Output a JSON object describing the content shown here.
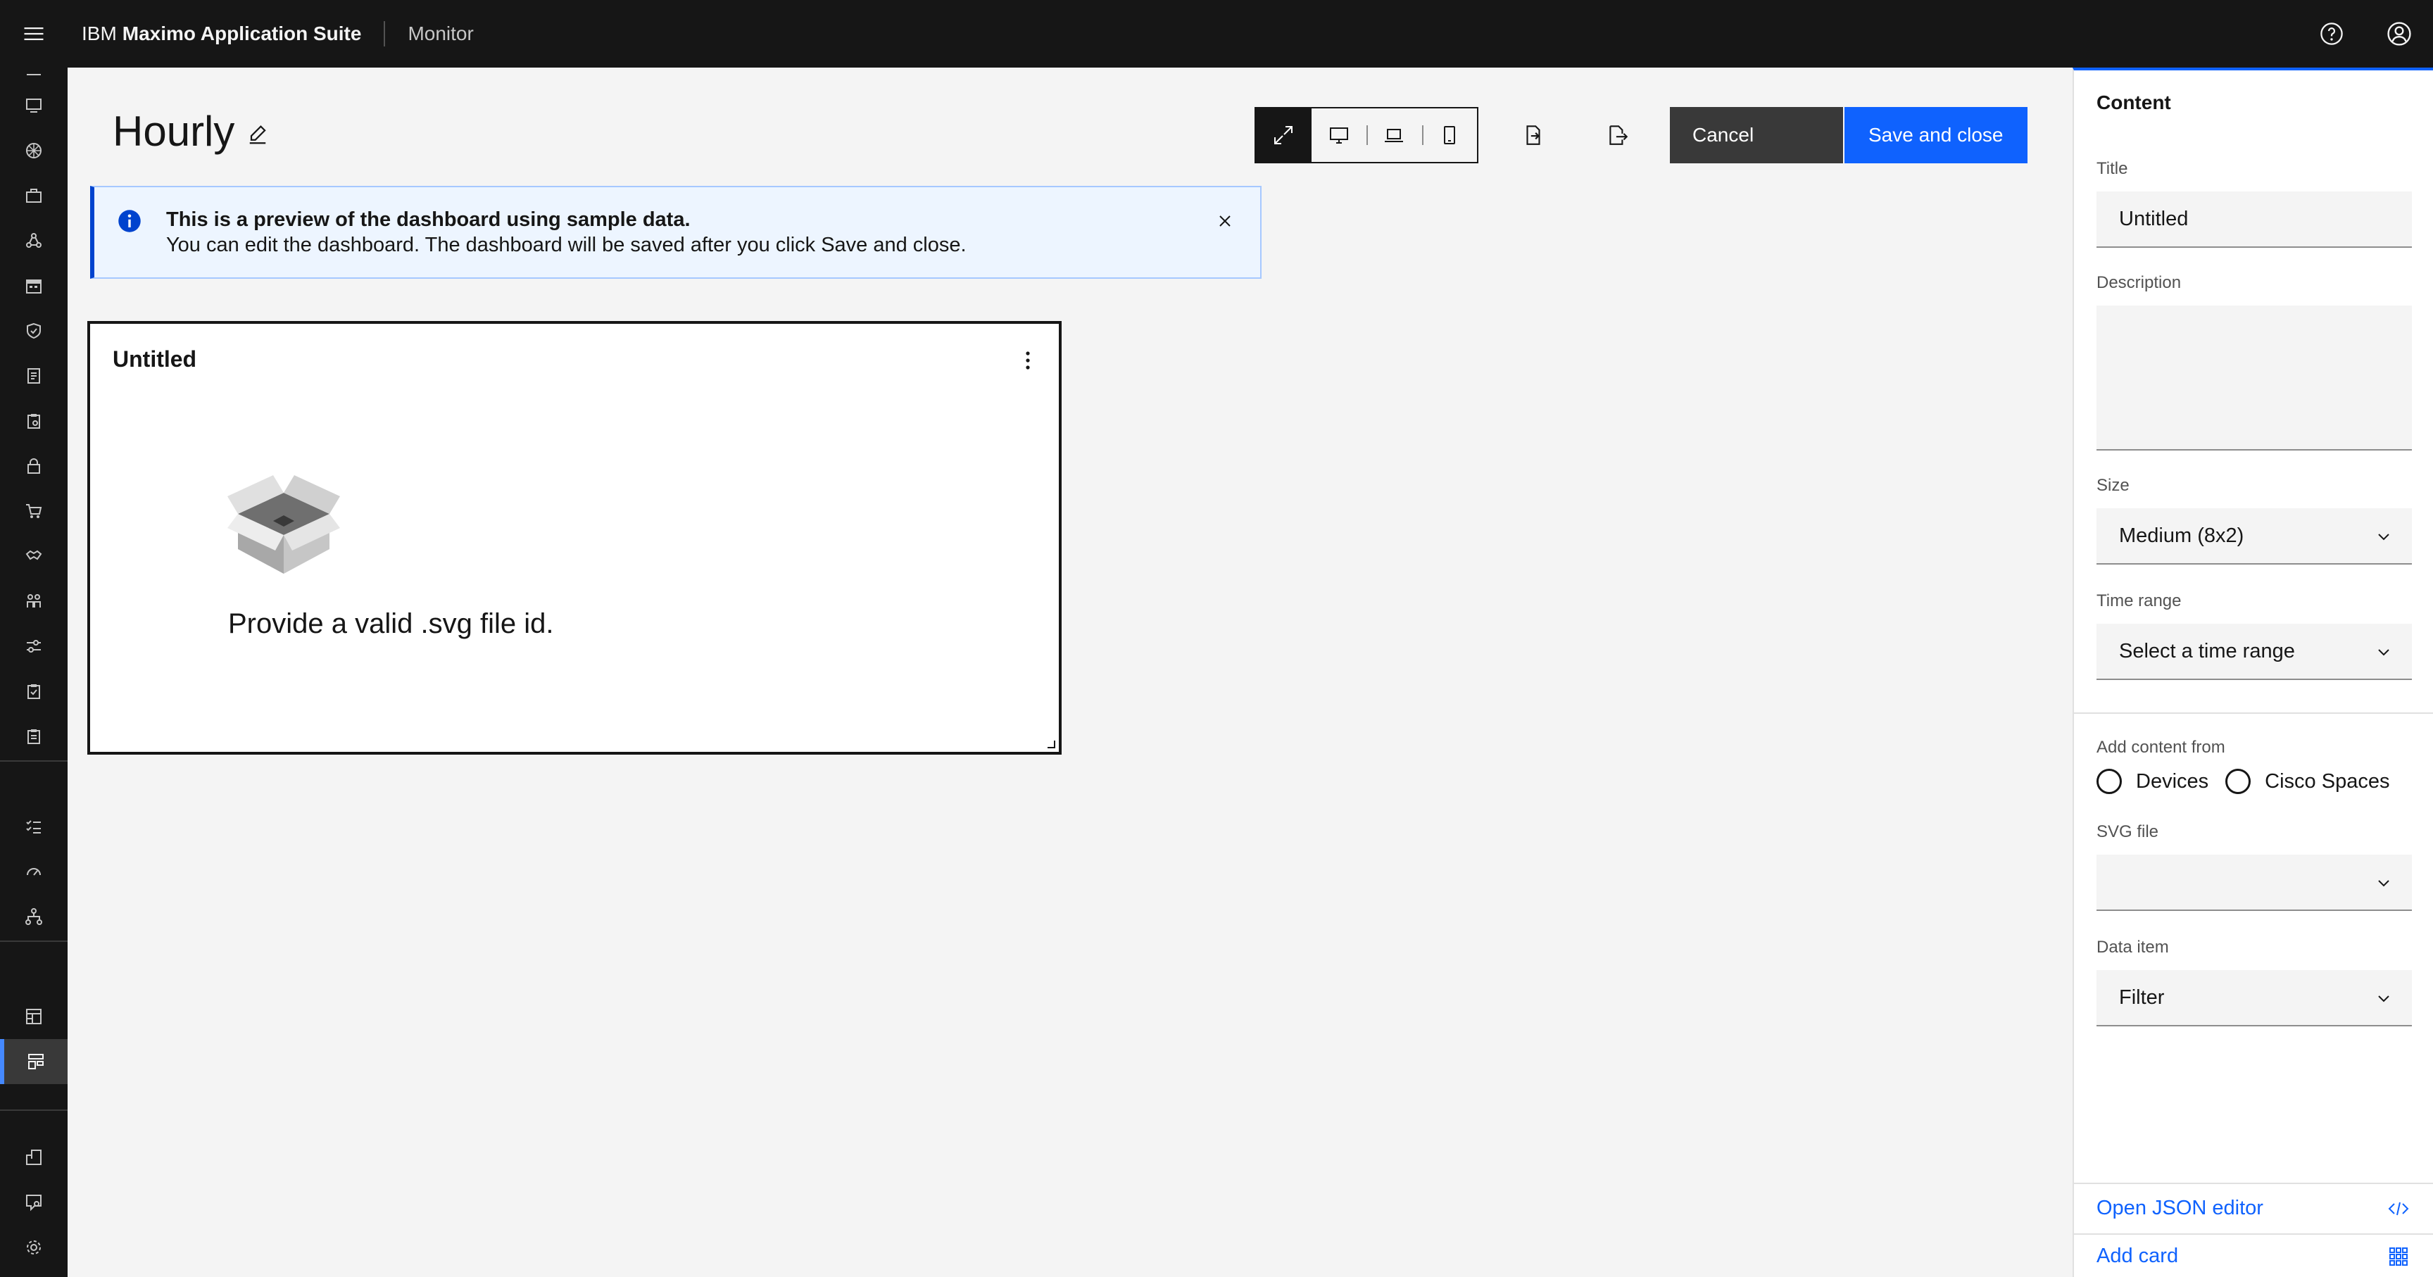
{
  "header": {
    "brand_prefix": "IBM",
    "brand_name": "Maximo Application Suite",
    "app_name": "Monitor",
    "icons": [
      "menu-icon",
      "help-icon",
      "user-avatar-icon"
    ]
  },
  "rail": {
    "items": [
      "dashboard-icon",
      "monitor-icon",
      "network-icon",
      "briefcase-icon",
      "flow-icon",
      "calendar-icon",
      "shield-icon",
      "report-icon",
      "clipboard-icon",
      "lock-icon",
      "cart-icon",
      "handshake-icon",
      "people-icon",
      "sliders-icon",
      "checklist-icon",
      "document-icon",
      "tasks-icon",
      "gauge-icon",
      "hierarchy-icon",
      "table-icon",
      "dashboard-layout-icon",
      "floorplan-icon",
      "chat-icon",
      "settings-icon"
    ],
    "active": "dashboard-layout-icon"
  },
  "page": {
    "title": "Hourly"
  },
  "toolbar": {
    "viewports": [
      "fit-to-screen-icon",
      "desktop-icon",
      "laptop-icon",
      "tablet-icon"
    ],
    "selected_viewport": "fit-to-screen-icon",
    "import_icon": "import-icon",
    "export_icon": "export-icon",
    "cancel_label": "Cancel",
    "save_label": "Save and close"
  },
  "notification": {
    "title": "This is a preview of the dashboard using sample data.",
    "subtitle": "You can edit the dashboard. The dashboard will be saved after you click Save and close."
  },
  "card": {
    "title": "Untitled",
    "message": "Provide a valid .svg file id."
  },
  "panel": {
    "heading": "Content",
    "title_label": "Title",
    "title_value": "Untitled",
    "description_label": "Description",
    "description_value": "",
    "size_label": "Size",
    "size_value": "Medium (8x2)",
    "time_range_label": "Time range",
    "time_range_value": "Select a time range",
    "add_content_label": "Add content from",
    "radio_devices": "Devices",
    "radio_cisco": "Cisco Spaces",
    "svg_file_label": "SVG file",
    "svg_file_value": "",
    "data_item_label": "Data item",
    "data_item_value": "Filter",
    "open_json_label": "Open JSON editor",
    "add_card_label": "Add card"
  },
  "colors": {
    "header_bg": "#161616",
    "accent": "#0f62fe",
    "notification_bg": "#edf5ff",
    "notification_border": "#0043ce",
    "secondary_button": "#393939"
  }
}
